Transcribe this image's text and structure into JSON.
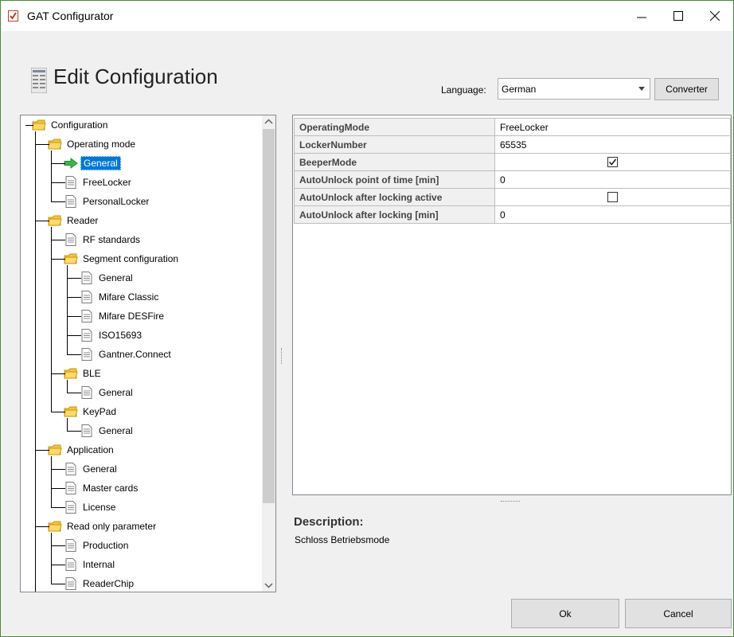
{
  "window": {
    "title": "GAT Configurator"
  },
  "header": {
    "title": "Edit Configuration",
    "language_label": "Language:",
    "language_value": "German",
    "converter_label": "Converter"
  },
  "tree": {
    "nodes": [
      {
        "label": "Configuration",
        "type": "folder",
        "level": 0
      },
      {
        "label": "Operating mode",
        "type": "folder",
        "level": 1
      },
      {
        "label": "General",
        "type": "arrow",
        "level": 2,
        "selected": true
      },
      {
        "label": "FreeLocker",
        "type": "doc",
        "level": 2
      },
      {
        "label": "PersonalLocker",
        "type": "doc",
        "level": 2
      },
      {
        "label": "Reader",
        "type": "folder",
        "level": 1
      },
      {
        "label": "RF standards",
        "type": "doc",
        "level": 2
      },
      {
        "label": "Segment configuration",
        "type": "folder",
        "level": 2
      },
      {
        "label": "General",
        "type": "doc",
        "level": 3
      },
      {
        "label": "Mifare Classic",
        "type": "doc",
        "level": 3
      },
      {
        "label": "Mifare DESFire",
        "type": "doc",
        "level": 3
      },
      {
        "label": "ISO15693",
        "type": "doc",
        "level": 3
      },
      {
        "label": "Gantner.Connect",
        "type": "doc",
        "level": 3
      },
      {
        "label": "BLE",
        "type": "folder",
        "level": 2
      },
      {
        "label": "General",
        "type": "doc",
        "level": 3
      },
      {
        "label": "KeyPad",
        "type": "folder",
        "level": 2
      },
      {
        "label": "General",
        "type": "doc",
        "level": 3
      },
      {
        "label": "Application",
        "type": "folder",
        "level": 1
      },
      {
        "label": "General",
        "type": "doc",
        "level": 2
      },
      {
        "label": "Master cards",
        "type": "doc",
        "level": 2
      },
      {
        "label": "License",
        "type": "doc",
        "level": 2
      },
      {
        "label": "Read only parameter",
        "type": "folder",
        "level": 1
      },
      {
        "label": "Production",
        "type": "doc",
        "level": 2
      },
      {
        "label": "Internal",
        "type": "doc",
        "level": 2
      },
      {
        "label": "ReaderChip",
        "type": "doc",
        "level": 2
      }
    ]
  },
  "properties": [
    {
      "name": "OperatingMode",
      "value": "FreeLocker",
      "kind": "text"
    },
    {
      "name": "LockerNumber",
      "value": "65535",
      "kind": "text"
    },
    {
      "name": "BeeperMode",
      "checked": true,
      "kind": "checkbox"
    },
    {
      "name": "AutoUnlock point of time [min]",
      "value": "0",
      "kind": "text"
    },
    {
      "name": "AutoUnlock after locking active",
      "checked": false,
      "kind": "checkbox"
    },
    {
      "name": "AutoUnlock after locking [min]",
      "value": "0",
      "kind": "text"
    }
  ],
  "description": {
    "title": "Description:",
    "text": "Schloss Betriebsmode"
  },
  "buttons": {
    "ok": "Ok",
    "cancel": "Cancel"
  },
  "colors": {
    "selection": "#0078d7",
    "folder": "#f5c542",
    "arrow": "#3fb44a"
  }
}
